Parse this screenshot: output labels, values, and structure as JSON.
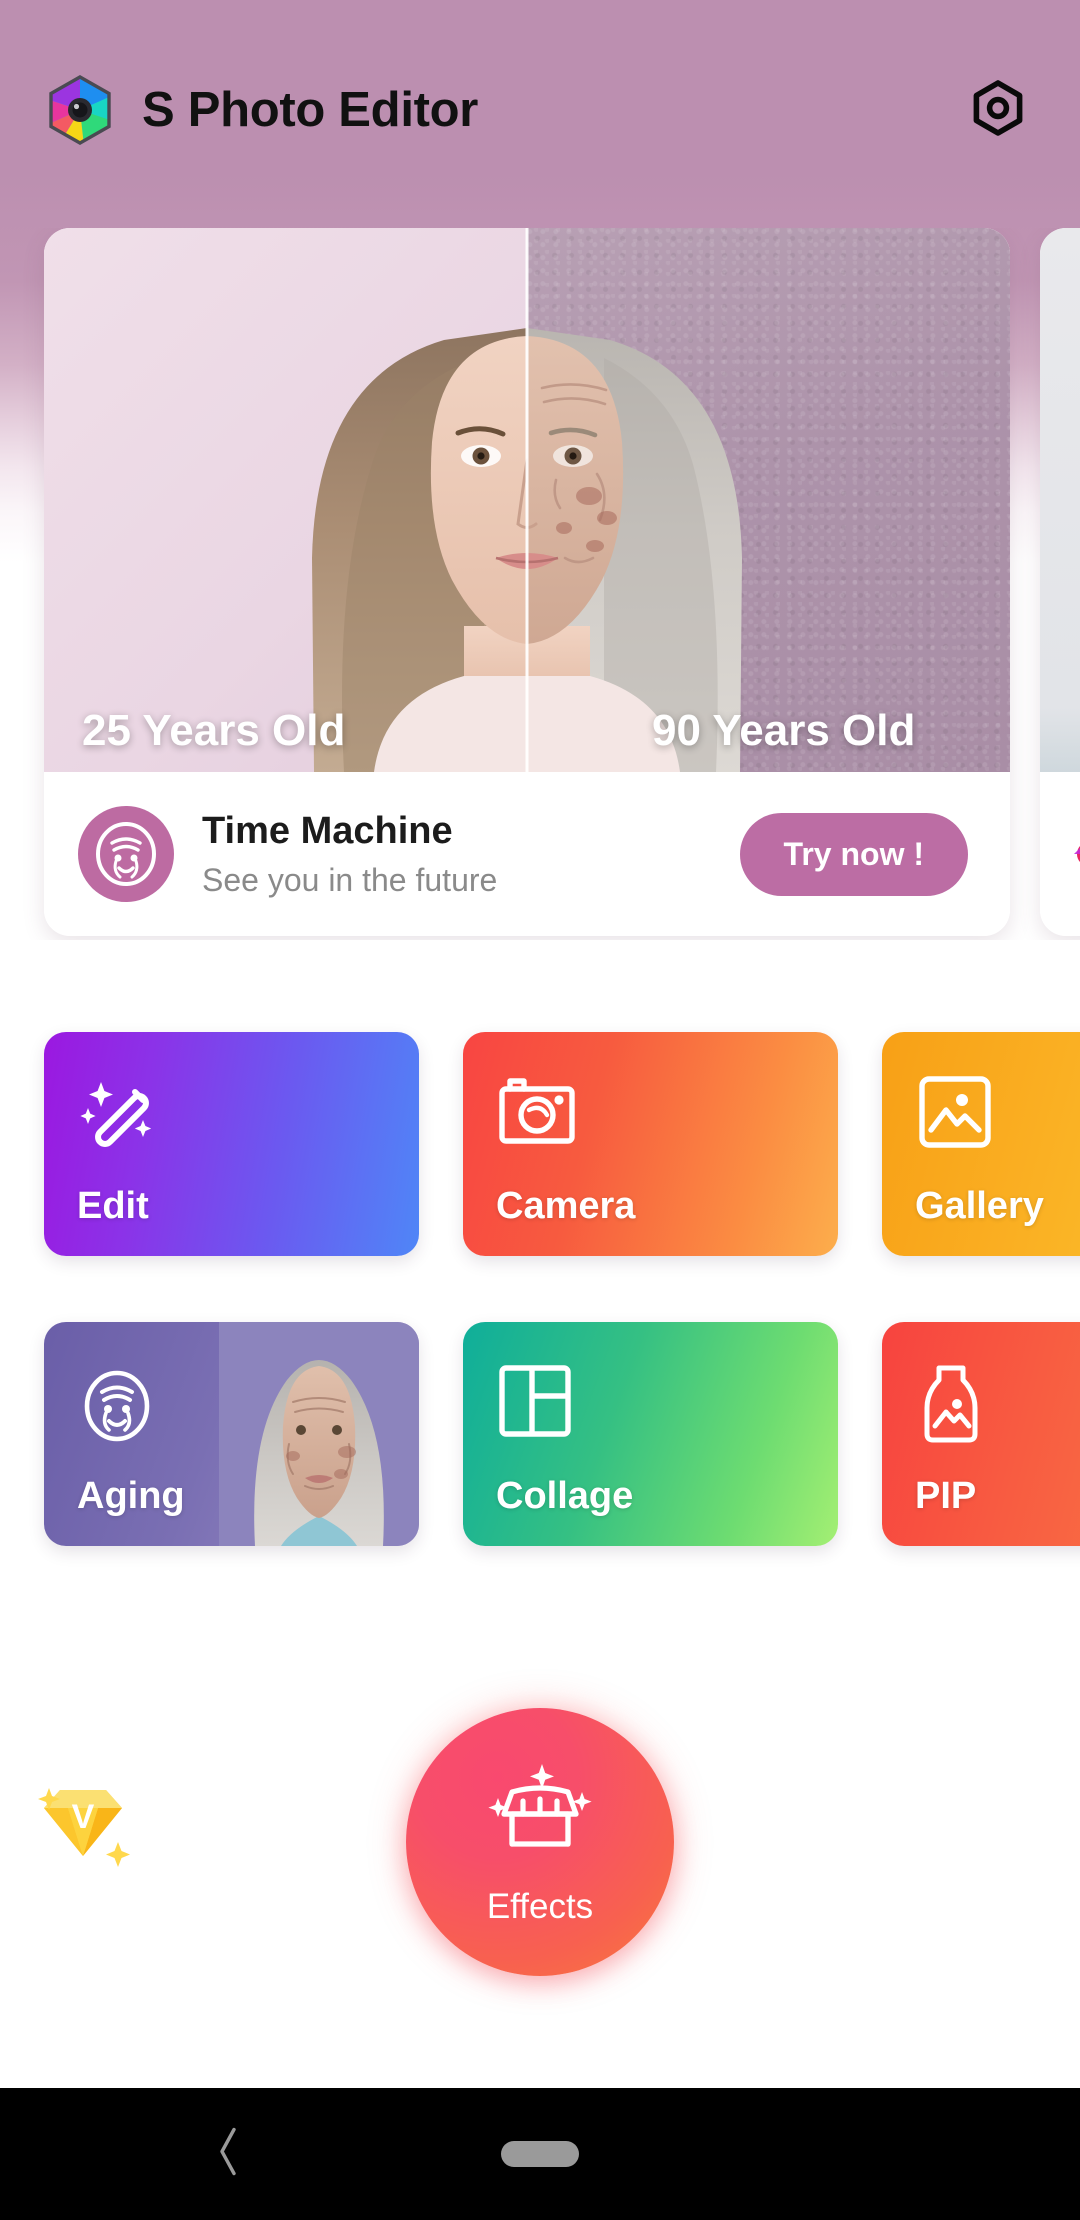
{
  "header": {
    "app_title": "S Photo Editor",
    "logo_icon": "photo-editor-hexagon-logo",
    "settings_icon": "hexagon-settings-icon"
  },
  "banner": {
    "left_age_label": "25 Years Old",
    "right_age_label": "90 Years Old",
    "badge_icon": "aging-face-icon",
    "title": "Time Machine",
    "subtitle": "See you in the future",
    "cta_label": "Try now !",
    "next_card_icon": "diamond-icon"
  },
  "tiles": {
    "row1": [
      {
        "label": "Edit",
        "icon": "magic-wand-icon",
        "accent": "#8b33e8"
      },
      {
        "label": "Camera",
        "icon": "camera-icon",
        "accent": "#f85b41"
      },
      {
        "label": "Gallery",
        "icon": "image-icon",
        "accent": "#fab023"
      }
    ],
    "row2": [
      {
        "label": "Aging",
        "icon": "aging-face-icon",
        "accent": "#7a6fb3"
      },
      {
        "label": "Collage",
        "icon": "grid-layout-icon",
        "accent": "#35c083"
      },
      {
        "label": "PIP",
        "icon": "bottle-image-icon",
        "accent": "#f85c41"
      }
    ]
  },
  "effects": {
    "label": "Effects",
    "icon": "store-stall-icon"
  },
  "vip": {
    "icon": "vip-diamond-icon",
    "letter": "V"
  },
  "navbar": {
    "back_icon": "back-chevron-icon",
    "home_icon": "home-pill-icon"
  }
}
